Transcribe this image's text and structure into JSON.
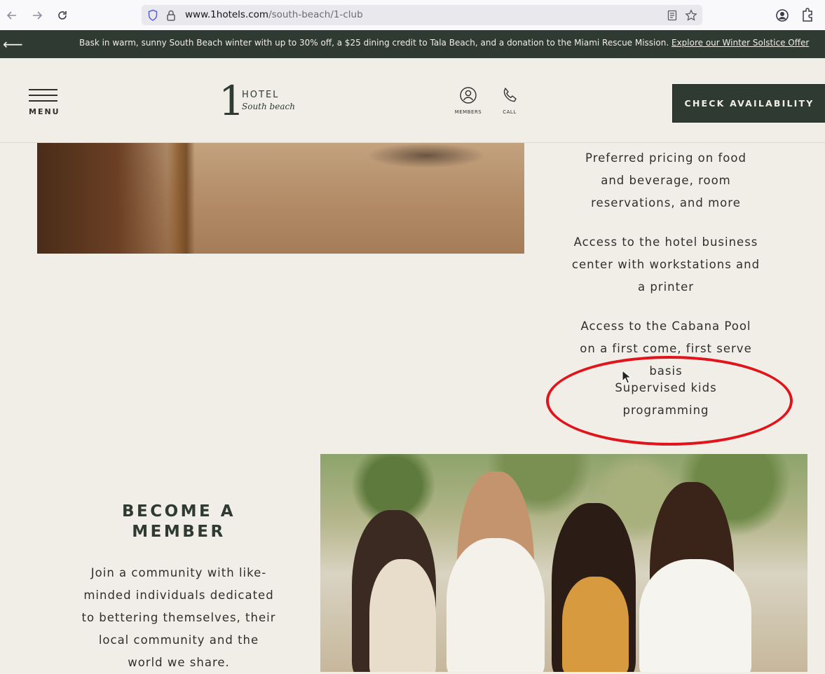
{
  "browser": {
    "url_host": "www.1hotels.com",
    "url_path": "/south-beach/1-club"
  },
  "promo": {
    "text": "Bask in warm, sunny South Beach winter with up to 30% off, a $25 dining credit to Tala Beach, and a donation to the Miami Rescue Mission.",
    "link": "Explore our Winter Solstice Offer"
  },
  "header": {
    "menu_label": "MENU",
    "logo_number": "1",
    "logo_hotel": "HOTEL",
    "logo_location": "South beach",
    "members_label": "MEMBERS",
    "call_label": "CALL",
    "cta_label": "CHECK AVAILABILITY"
  },
  "perks": [
    "Preferred pricing on food and beverage, room reservations, and more",
    "Access to the hotel business center with workstations and a printer",
    "Access to the Cabana Pool on a first come, first serve basis",
    "Supervised kids programming"
  ],
  "become": {
    "title": "BECOME A MEMBER",
    "body": "Join a community with like-minded individuals dedicated to bettering themselves, their local community and the world we share."
  },
  "colors": {
    "brand_dark": "#2f3a32",
    "background": "#f1eee8",
    "annotation": "#e0141a"
  }
}
